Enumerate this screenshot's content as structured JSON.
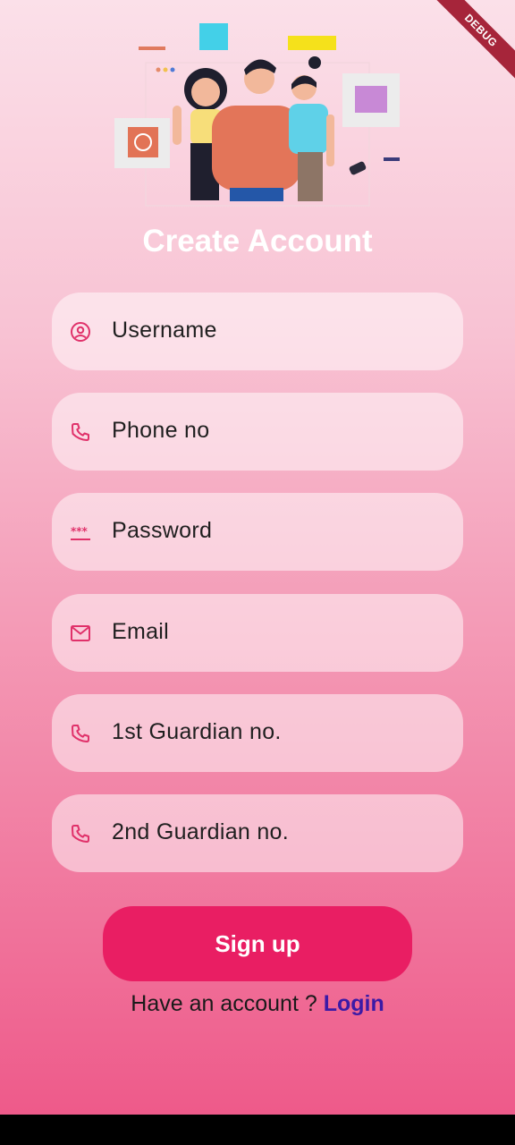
{
  "debug_banner": "DEBUG",
  "title": "Create Account",
  "fields": [
    {
      "placeholder": "Username",
      "icon": "account-circle-icon"
    },
    {
      "placeholder": "Phone no",
      "icon": "phone-icon"
    },
    {
      "placeholder": "Password",
      "icon": "password-icon"
    },
    {
      "placeholder": "Email",
      "icon": "mail-icon"
    },
    {
      "placeholder": "1st Guardian no.",
      "icon": "phone-icon"
    },
    {
      "placeholder": "2nd Guardian no.",
      "icon": "phone-icon"
    }
  ],
  "signup_button": "Sign up",
  "login_prompt": "Have an account ?",
  "login_link": "Login",
  "colors": {
    "accent": "#e91e63",
    "icon": "#e0316a",
    "link": "#3b1aa6"
  }
}
